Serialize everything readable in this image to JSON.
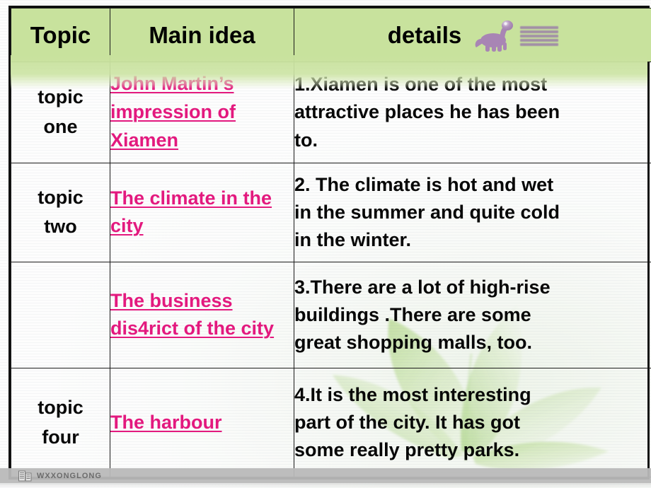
{
  "slide": {
    "title": "Topic / Main idea / details table",
    "accent_green": "#c8e29d",
    "accent_pink": "#e3197e",
    "text_black": "#070707",
    "footer_band_color": "#b9b9b9"
  },
  "table": {
    "headers": {
      "topic": "Topic",
      "main_idea": "Main idea",
      "details": "details"
    },
    "rows": [
      {
        "topic": "topic\none",
        "topic_line1": "topic",
        "topic_line2": "one",
        "main_idea": "John Martin’s impression of Xiamen",
        "details_line1": "1.Xiamen is one of the most",
        "details_line2": "attractive places he has been",
        "details_line3": "to."
      },
      {
        "topic_line1": "topic",
        "topic_line2": "two",
        "main_idea": "The climate in the city",
        "details_line1": "2. The climate is hot and wet",
        "details_line2": "in the summer and quite cold",
        "details_line3": "in the winter."
      },
      {
        "topic_line1": "",
        "topic_line2": "",
        "main_idea": "The business dis4rict of the city",
        "details_line1": "3.There are a lot of high-rise",
        "details_line2": "buildings .There are some",
        "details_line3": "great shopping malls, too."
      },
      {
        "topic_line1": "topic",
        "topic_line2": "four",
        "main_idea": "The harbour",
        "details_line1": "4.It is the most interesting",
        "details_line2": "part of the city. It has got",
        "details_line3": "some really pretty parks."
      }
    ]
  },
  "decorations": {
    "dinosaur_logo": "brontosaurus-icon",
    "leaf_watermark": "leaf-watermark-icon"
  },
  "footer": {
    "watermark_text": "WXXONGLONG",
    "watermark_logo": "building-watermark-icon"
  }
}
